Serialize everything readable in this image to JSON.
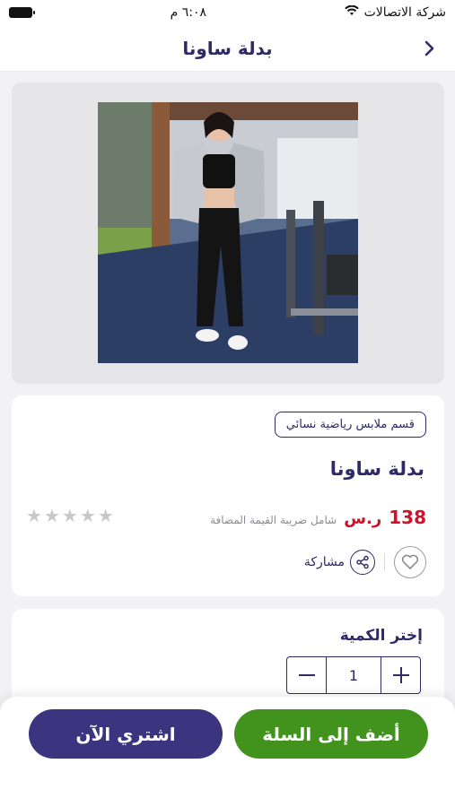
{
  "status_bar": {
    "carrier": "شركة الاتصالات",
    "time": "٦:٠٨ م"
  },
  "header": {
    "title": "بدلة ساونا"
  },
  "product": {
    "category": "قسم ملابس رياضية نسائي",
    "name": "بدلة ساونا",
    "price": "138",
    "currency": "ر.س",
    "vat_note": "شامل ضريبة القيمة المضافة",
    "rating": 0,
    "rating_max": 5,
    "share_label": "مشاركة"
  },
  "quantity": {
    "title": "إختر الكمية",
    "value": "1"
  },
  "actions": {
    "add_to_cart": "أضف إلى السلة",
    "buy_now": "اشتري الآن"
  },
  "colors": {
    "primary": "#2d2a66",
    "price": "#d0112b",
    "cart_button": "#42921e",
    "buy_button": "#3b3580"
  }
}
